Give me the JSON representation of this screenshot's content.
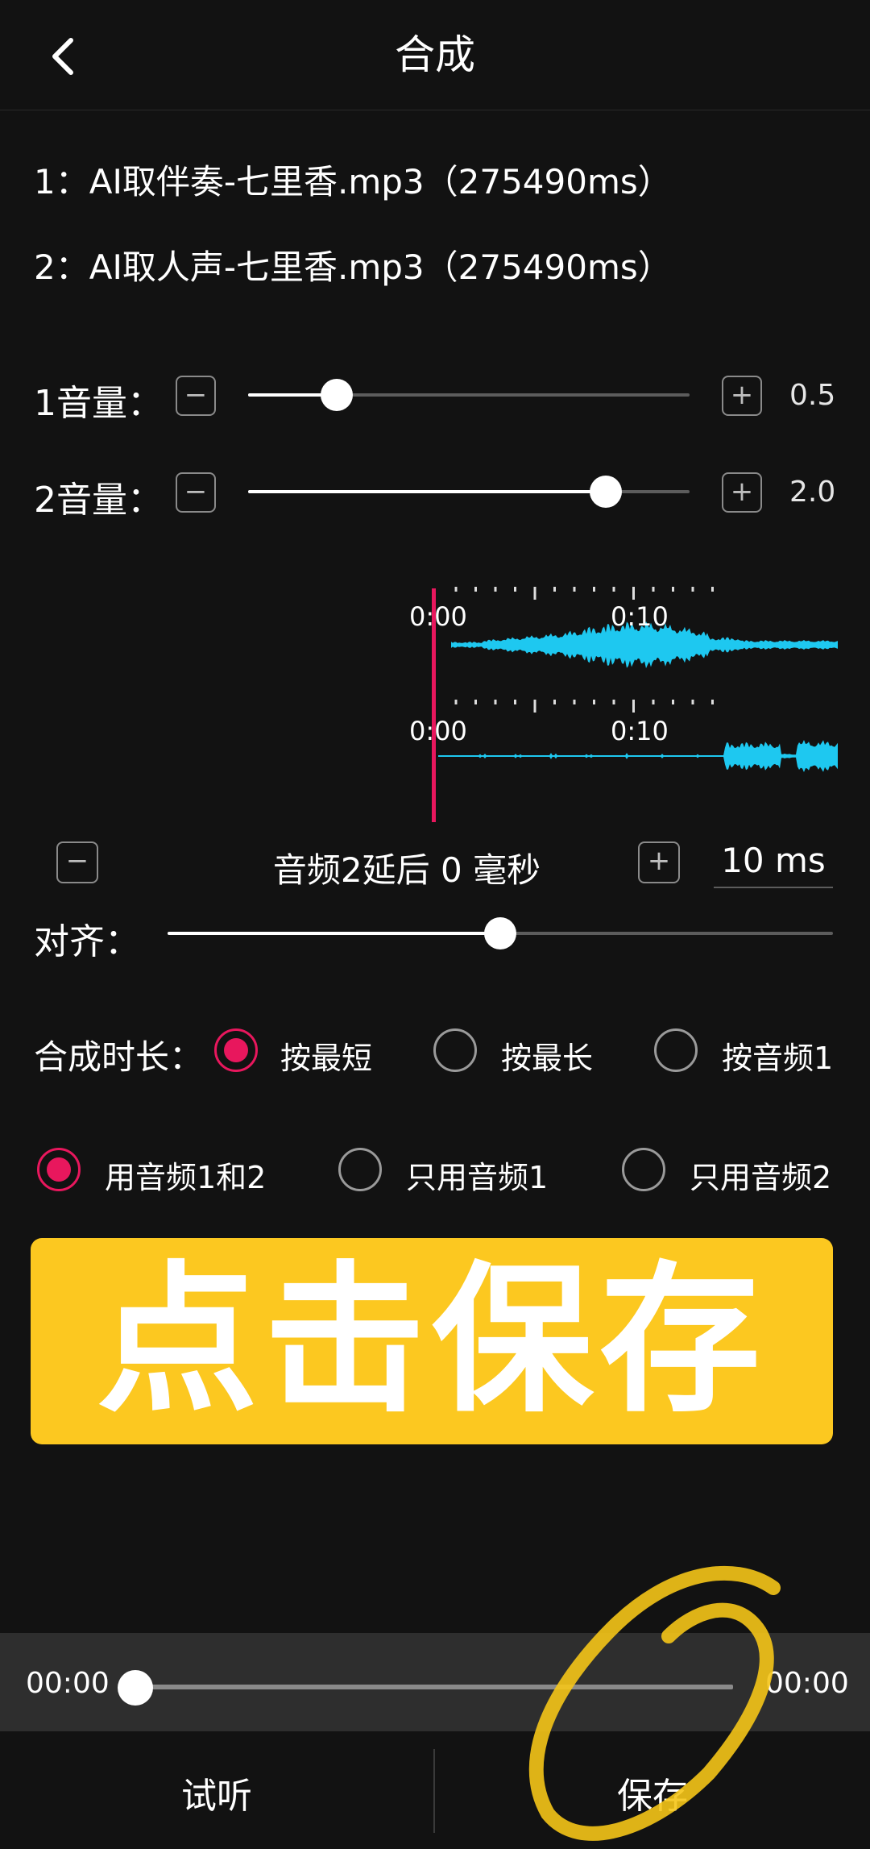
{
  "header": {
    "title": "合成"
  },
  "files": [
    {
      "label": "1：AI取伴奏-七里香.mp3（275490ms）"
    },
    {
      "label": "2：AI取人声-七里香.mp3（275490ms）"
    }
  ],
  "volumes": [
    {
      "label": "1音量：",
      "value": "0.5",
      "level": 0.2
    },
    {
      "label": "2音量：",
      "value": "2.0",
      "level": 0.81
    }
  ],
  "waveform": {
    "track1": {
      "start": "0:00",
      "mark": "0:10"
    },
    "track2": {
      "start": "0:00",
      "mark": "0:10"
    },
    "wave_color": "#1ec8f0",
    "playhead_color": "#e8175d"
  },
  "delay": {
    "text": "音频2延后 0 毫秒",
    "step": "10 ms"
  },
  "align": {
    "label": "对齐：",
    "level": 0.5
  },
  "duration": {
    "label": "合成时长：",
    "options": [
      "按最短",
      "按最长",
      "按音频1"
    ],
    "selected": 0
  },
  "source": {
    "options": [
      "用音频1和2",
      "只用音频1",
      "只用音频2"
    ],
    "selected": 0
  },
  "save_banner": {
    "text": "点击保存",
    "color": "#fcc820"
  },
  "player": {
    "current": "00:00",
    "total": "00:00",
    "progress": 0
  },
  "bottom": {
    "listen": "试听",
    "save": "保存"
  },
  "accent": "#e8175d"
}
